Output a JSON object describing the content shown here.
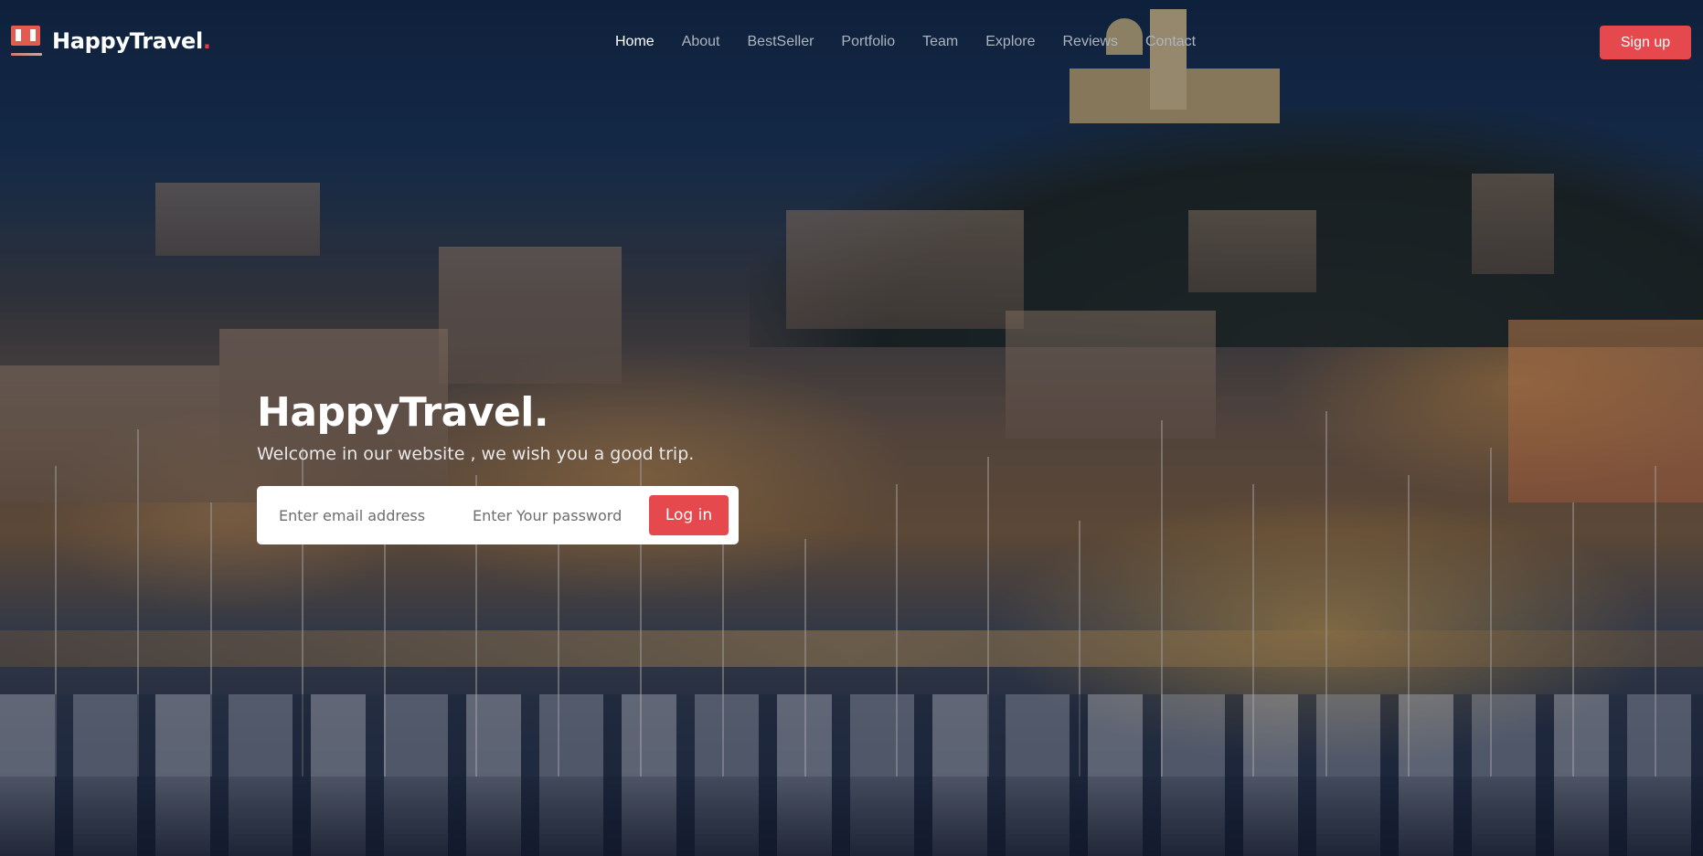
{
  "brand": {
    "name": "HappyTravel",
    "dot": ".",
    "logo_icon": "suitcase-logo-icon"
  },
  "nav": {
    "items": [
      {
        "label": "Home",
        "active": true
      },
      {
        "label": "About",
        "active": false
      },
      {
        "label": "BestSeller",
        "active": false
      },
      {
        "label": "Portfolio",
        "active": false
      },
      {
        "label": "Team",
        "active": false
      },
      {
        "label": "Explore",
        "active": false
      },
      {
        "label": "Reviews",
        "active": false
      },
      {
        "label": "Contact",
        "active": false
      }
    ],
    "signup_label": "Sign up"
  },
  "hero": {
    "title": "HappyTravel.",
    "subtitle": "Welcome in our website , we wish you a good trip.",
    "background": "night-harbor-city-photo"
  },
  "login": {
    "email_placeholder": "Enter email address",
    "password_placeholder": "Enter Your password",
    "button_label": "Log in"
  },
  "colors": {
    "accent": "#e5484d",
    "nav_active": "#ffffff",
    "nav_inactive": "#aeb4bd"
  }
}
